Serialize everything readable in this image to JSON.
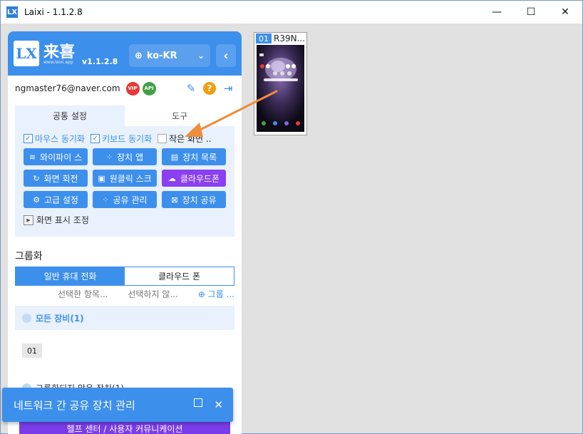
{
  "window": {
    "app_icon_text": "LX",
    "title": "Laixi - 1.1.2.8",
    "controls": {
      "minimize": "—",
      "maximize": "☐",
      "close": "✕"
    }
  },
  "header": {
    "logo_mark": "LX",
    "logo_text": "来喜",
    "logo_sub": "www.laixi.app",
    "version": "v1.1.2.8",
    "language": "ko-KR",
    "back_glyph": "‹"
  },
  "user": {
    "email": "ngmaster76@naver.com",
    "vip_label": "VIP",
    "api_label": "API"
  },
  "settings": {
    "tabs": [
      "공통 설정",
      "도구"
    ],
    "checkboxes": [
      {
        "label": "마우스 동기화",
        "checked": true
      },
      {
        "label": "키보드 동기화",
        "checked": true
      },
      {
        "label": "작은 화면 ..",
        "checked": false
      }
    ],
    "buttons": [
      {
        "label": "와이파이 스",
        "icon": "wifi-icon",
        "glyph": "≋",
        "color": "#3d8fec"
      },
      {
        "label": "장치 앱",
        "icon": "apps-icon",
        "glyph": "⁘",
        "color": "#3d8fec"
      },
      {
        "label": "장치 목록",
        "icon": "list-icon",
        "glyph": "▤",
        "color": "#3d8fec"
      },
      {
        "label": "화면 회전",
        "icon": "rotate-icon",
        "glyph": "↻",
        "color": "#3d8fec"
      },
      {
        "label": "원클릭 스크",
        "icon": "screenshot-icon",
        "glyph": "▣",
        "color": "#3d8fec"
      },
      {
        "label": "클라우드폰",
        "icon": "cloud-icon",
        "glyph": "☁",
        "color": "#8a3ff0"
      },
      {
        "label": "고급 설정",
        "icon": "gear-icon",
        "glyph": "⚙",
        "color": "#3d8fec"
      },
      {
        "label": "공유 관리",
        "icon": "share-manage-icon",
        "glyph": "⁘",
        "color": "#3d8fec"
      },
      {
        "label": "장치 공유",
        "icon": "device-share-icon",
        "glyph": "⊠",
        "color": "#3d8fec"
      }
    ],
    "display_adjust": "화면 표시 조정"
  },
  "grouping": {
    "title": "그룹화",
    "segments": [
      "일반 휴대 전화",
      "클라우드 폰"
    ],
    "actions": [
      "선택한 항목...",
      "선택하지 않...",
      "⊕ 그룹 ..."
    ],
    "all_devices": "모든 장비(1)",
    "device_chip": "01",
    "ungrouped": "그룹화되지 않은 장치(1)",
    "help_bar": "헬프 센터 / 사용자 커뮤니케이션"
  },
  "toast": {
    "message": "네트워크 간 공유 장치 관리",
    "close": "✕"
  },
  "device": {
    "number": "01",
    "name": "R39N..."
  },
  "colors": {
    "accent": "#3d8fec",
    "purple": "#8a3ff0",
    "arrow": "#f08c3a"
  }
}
